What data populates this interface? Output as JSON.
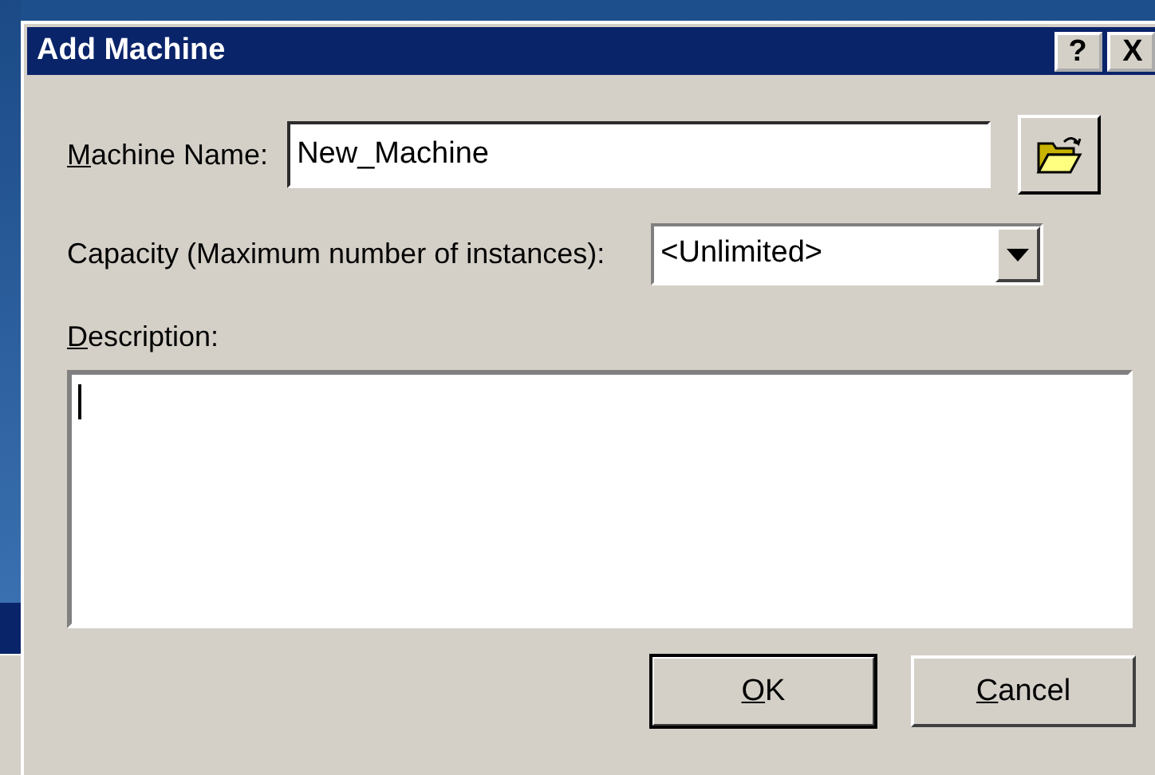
{
  "window": {
    "title": "Add Machine",
    "buttons": [
      {
        "kind": "help",
        "label": "?"
      },
      {
        "kind": "close",
        "label": "X"
      }
    ]
  },
  "machine_name": {
    "label": {
      "mnemonic": "M",
      "rest": "achine Name:"
    },
    "value": "New_Machine"
  },
  "capacity": {
    "label": "Capacity (Maximum number of instances):",
    "value": "<Unlimited>"
  },
  "description": {
    "label": {
      "mnemonic": "D",
      "rest": "escription:"
    },
    "focused": true
  },
  "buttons": [
    {
      "mnemonic": "O",
      "rest": "K",
      "default": true
    },
    {
      "mnemonic": "C",
      "rest": "ancel",
      "default": false
    }
  ]
}
